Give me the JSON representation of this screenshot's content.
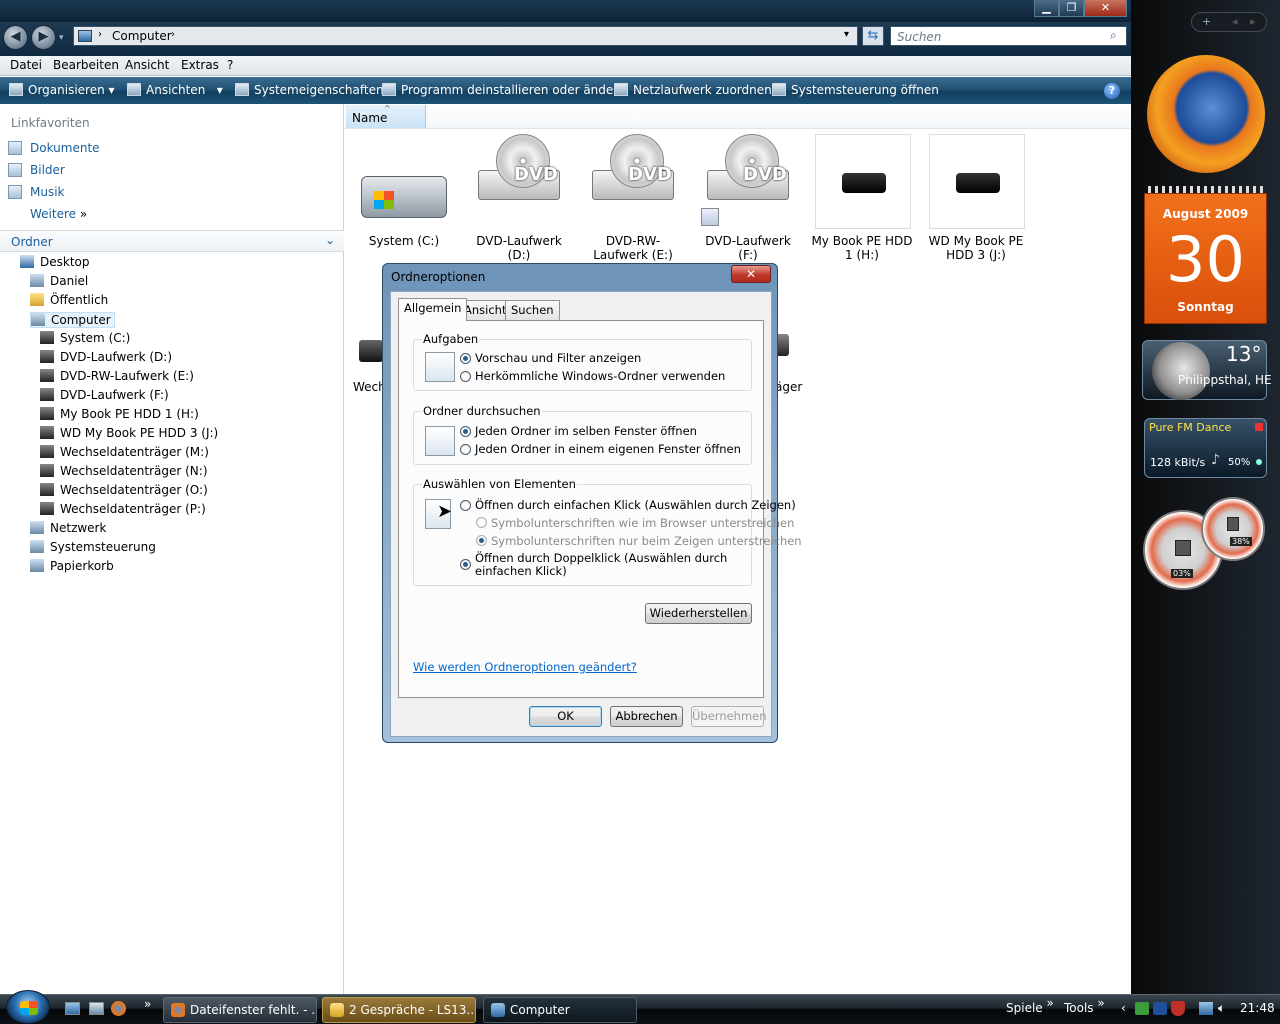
{
  "window": {
    "controls": [
      "minimize-icon",
      "restore-icon",
      "close-icon"
    ]
  },
  "address": {
    "path": "Computer",
    "search_placeholder": "Suchen"
  },
  "menu": [
    "Datei",
    "Bearbeiten",
    "Ansicht",
    "Extras",
    "?"
  ],
  "commands": [
    "Organisieren",
    "Ansichten",
    "Systemeigenschaften",
    "Programm deinstallieren oder ändern",
    "Netzlaufwerk zuordnen",
    "Systemsteuerung öffnen"
  ],
  "nav": {
    "linkfavoriten_label": "Linkfavoriten",
    "favorites": [
      "Dokumente",
      "Bilder",
      "Musik",
      "Weitere"
    ],
    "ordner_label": "Ordner",
    "tree": [
      {
        "label": "Desktop",
        "level": 0
      },
      {
        "label": "Daniel",
        "level": 1
      },
      {
        "label": "Öffentlich",
        "level": 1
      },
      {
        "label": "Computer",
        "level": 1
      },
      {
        "label": "System (C:)",
        "level": 2
      },
      {
        "label": "DVD-Laufwerk (D:)",
        "level": 2
      },
      {
        "label": "DVD-RW-Laufwerk (E:)",
        "level": 2
      },
      {
        "label": "DVD-Laufwerk (F:)",
        "level": 2
      },
      {
        "label": "My Book PE HDD 1 (H:)",
        "level": 2
      },
      {
        "label": "WD My Book PE HDD 3 (J:)",
        "level": 2
      },
      {
        "label": "Wechseldatenträger (M:)",
        "level": 2
      },
      {
        "label": "Wechseldatenträger (N:)",
        "level": 2
      },
      {
        "label": "Wechseldatenträger (O:)",
        "level": 2
      },
      {
        "label": "Wechseldatenträger (P:)",
        "level": 2
      },
      {
        "label": "Netzwerk",
        "level": 1
      },
      {
        "label": "Systemsteuerung",
        "level": 1
      },
      {
        "label": "Papierkorb",
        "level": 1
      }
    ]
  },
  "content": {
    "column_name": "Name",
    "items": [
      {
        "label": "System (C:)",
        "kind": "hdd-system"
      },
      {
        "label": "DVD-Laufwerk (D:)",
        "kind": "dvd",
        "disc_text": "DVD"
      },
      {
        "label": "DVD-RW-Laufwerk (E:)",
        "kind": "dvd",
        "disc_text": "DVD"
      },
      {
        "label": "DVD-Laufwerk (F:)",
        "kind": "dvd",
        "disc_text": "DVD"
      },
      {
        "label": "My Book PE HDD 1 (H:)",
        "kind": "external"
      },
      {
        "label": "WD My Book PE HDD 3 (J:)",
        "kind": "external"
      }
    ],
    "row2_partial_left": "Wech",
    "row2_partial_right": "äger"
  },
  "dialog": {
    "title": "Ordneroptionen",
    "tabs": [
      "Allgemein",
      "Ansicht",
      "Suchen"
    ],
    "active_tab": "Allgemein",
    "group_tasks": {
      "title": "Aufgaben",
      "options": [
        "Vorschau und Filter anzeigen",
        "Herkömmliche Windows-Ordner verwenden"
      ],
      "selected": 0
    },
    "group_browse": {
      "title": "Ordner durchsuchen",
      "options": [
        "Jeden Ordner im selben Fenster öffnen",
        "Jeden Ordner in einem eigenen Fenster öffnen"
      ],
      "selected": 0
    },
    "group_select": {
      "title": "Auswählen von Elementen",
      "option_single": "Öffnen durch einfachen Klick (Auswählen durch Zeigen)",
      "sub_options": [
        "Symbolunterschriften wie im Browser unterstreichen",
        "Symbolunterschriften nur beim Zeigen unterstreichen"
      ],
      "option_double": "Öffnen durch Doppelklick (Auswählen durch einfachen Klick)"
    },
    "restore_label": "Wiederherstellen",
    "help_link": "Wie werden Ordneroptionen geändert?",
    "ok_label": "OK",
    "cancel_label": "Abbrechen",
    "apply_label": "Übernehmen"
  },
  "gadgets": {
    "calendar": {
      "month": "August 2009",
      "day": "30",
      "weekday": "Sonntag"
    },
    "weather": {
      "temp": "13°",
      "location": "Philippsthal, HE"
    },
    "radio": {
      "station": "Pure FM Dance",
      "bitrate": "128 kBit/s",
      "volume": "50%"
    },
    "cpu": {
      "cpu": "03%",
      "mem": "38%"
    }
  },
  "taskbar": {
    "tasks": [
      "Dateifenster fehlt. - ...",
      "2 Gespräche - LS13...",
      "Computer"
    ],
    "toolbars": [
      "Spiele",
      "Tools"
    ],
    "clock": "21:48"
  }
}
